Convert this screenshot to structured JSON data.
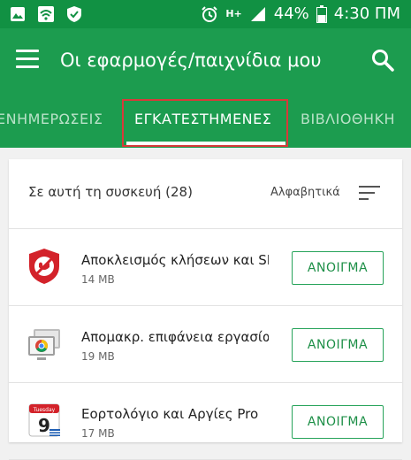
{
  "status_bar": {
    "battery_percent": "44%",
    "time": "4:30 ΠΜ",
    "network": "H+"
  },
  "app_bar": {
    "title": "Οι εφαρμογές/παιχνίδια μου"
  },
  "tabs": [
    {
      "label": "ΕΝΗΜΕΡΩΣΕΙΣ"
    },
    {
      "label": "ΕΓΚΑΤΕΣΤΗΜΕΝΕΣ"
    },
    {
      "label": "ΒΙΒΛΙΟΘΗΚΗ"
    }
  ],
  "list_header": {
    "count_label": "Σε αυτή τη συσκευή (28)",
    "sort_label": "Αλφαβητικά"
  },
  "apps": [
    {
      "name": "Αποκλεισμός κλήσεων και SMS",
      "size": "14 MB",
      "button": "ΑΝΟΙΓΜΑ"
    },
    {
      "name": "Απομακρ. επιφάνεια εργασίας",
      "size": "19 MB",
      "button": "ΑΝΟΙΓΜΑ"
    },
    {
      "name": "Εορτολόγιο και Αργίες Pro",
      "size": "17 MB",
      "button": "ΑΝΟΙΓΜΑ",
      "icon_text": "Tuesday",
      "icon_day": "9"
    }
  ],
  "colors": {
    "primary": "#1c9c4f",
    "status_bar": "#119143",
    "highlight": "#d83a3a"
  }
}
